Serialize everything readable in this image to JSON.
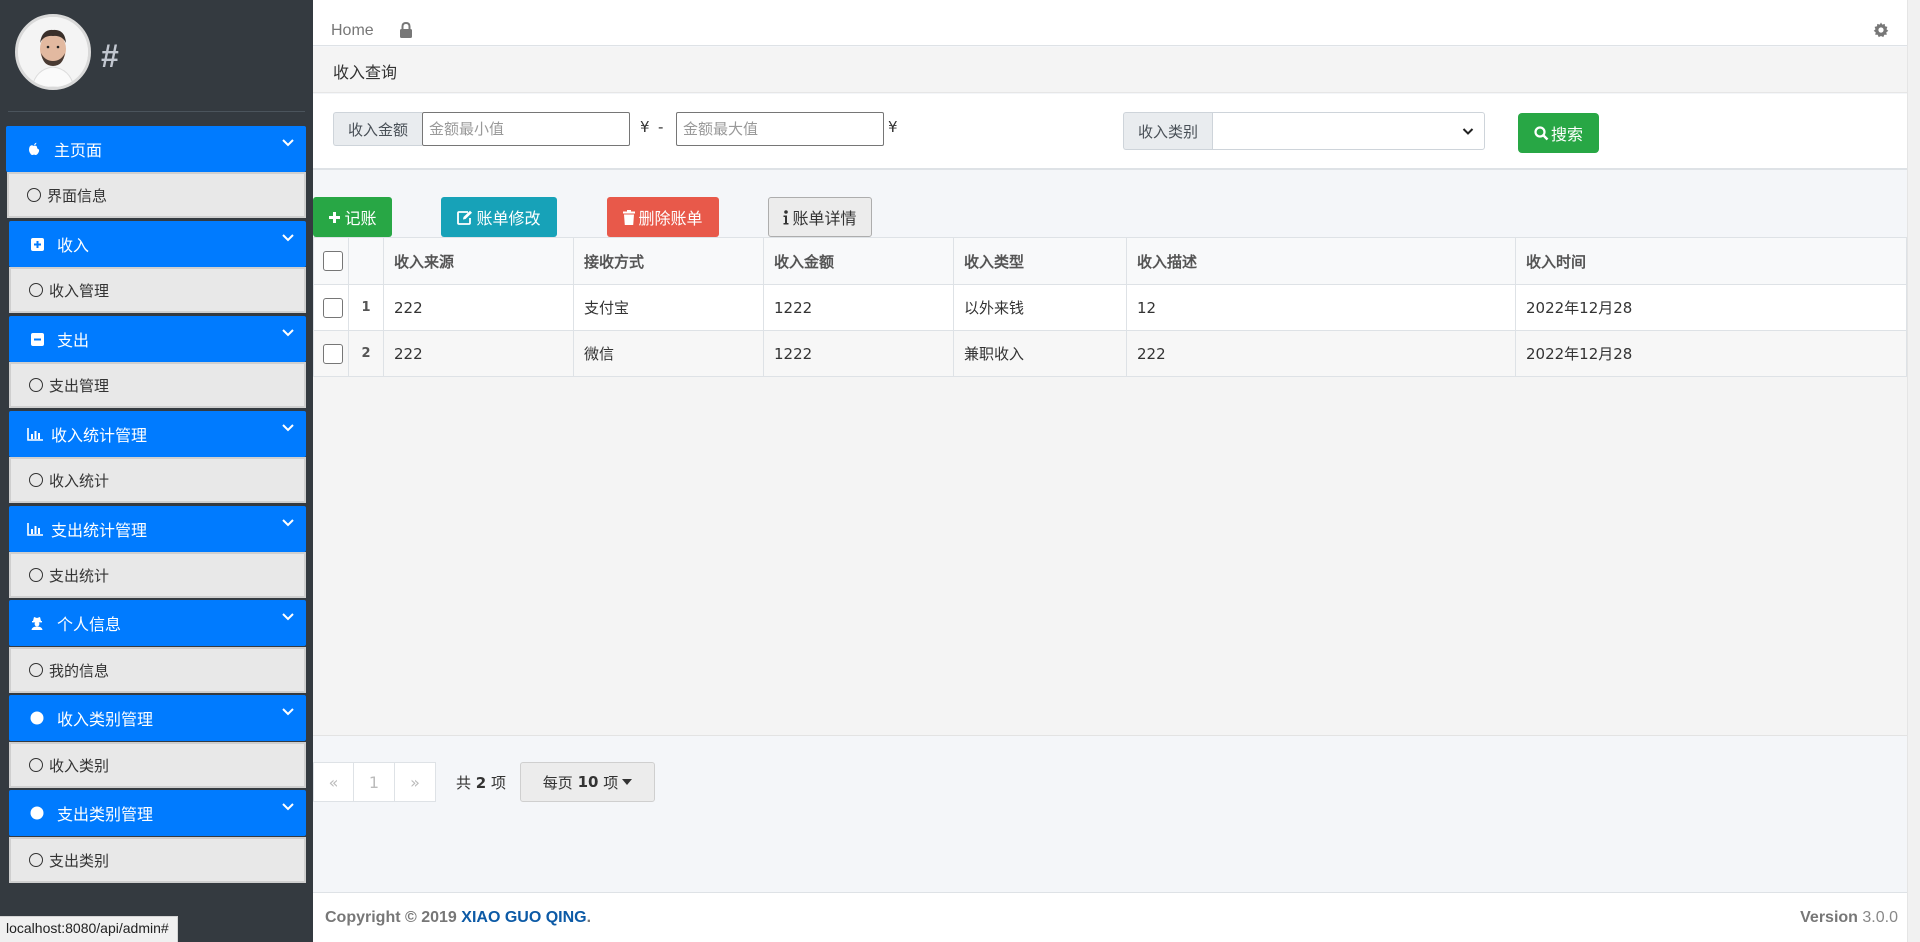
{
  "sidebar": {
    "brand_hash": "#",
    "menu": [
      {
        "head": "主页面",
        "icon": "apple-icon",
        "sub": "界面信息"
      },
      {
        "head": "收入",
        "icon": "plus-square-icon",
        "sub": "收入管理"
      },
      {
        "head": "支出",
        "icon": "minus-square-icon",
        "sub": "支出管理"
      },
      {
        "head": "收入统计管理",
        "icon": "bar-chart-icon",
        "sub": "收入统计"
      },
      {
        "head": "支出统计管理",
        "icon": "bar-chart-icon",
        "sub": "支出统计"
      },
      {
        "head": "个人信息",
        "icon": "user-secret-icon",
        "sub": "我的信息"
      },
      {
        "head": "收入类别管理",
        "icon": "circle-icon",
        "sub": "收入类别"
      },
      {
        "head": "支出类别管理",
        "icon": "circle-icon",
        "sub": "支出类别"
      }
    ]
  },
  "status_url": "localhost:8080/api/admin#",
  "topbar": {
    "home": "Home"
  },
  "breadcrumb": "收入查询",
  "filter": {
    "amount_label": "收入金额",
    "min_placeholder": "金额最小值",
    "max_placeholder": "金额最大值",
    "currency": "¥",
    "dash": "-",
    "category_label": "收入类别",
    "search_label": "搜索"
  },
  "toolbar": {
    "add": "记账",
    "edit": "账单修改",
    "delete": "删除账单",
    "detail": "账单详情"
  },
  "table": {
    "columns": [
      "收入来源",
      "接收方式",
      "收入金额",
      "收入类型",
      "收入描述",
      "收入时间"
    ],
    "rows": [
      {
        "n": "1",
        "cells": [
          "222",
          "支付宝",
          "1222",
          "以外来钱",
          "12",
          "2022年12月28"
        ]
      },
      {
        "n": "2",
        "cells": [
          "222",
          "微信",
          "1222",
          "兼职收入",
          "222",
          "2022年12月28"
        ]
      }
    ]
  },
  "pagination": {
    "prev": "«",
    "page": "1",
    "next": "»",
    "total_prefix": "共",
    "total_count": "2",
    "total_suffix": "项",
    "per_page_prefix": "每页",
    "per_page_count": "10",
    "per_page_suffix": "项"
  },
  "footer": {
    "copyright": "Copyright © 2019",
    "brand": "XIAO GUO QING",
    "dot": ".",
    "version_label": "Version",
    "version": "3.0.0"
  },
  "colors": {
    "sidebar_bg": "#343a40",
    "menu_active": "#007bff",
    "success": "#28a745",
    "info": "#17a2b8",
    "danger": "#e8594a"
  }
}
